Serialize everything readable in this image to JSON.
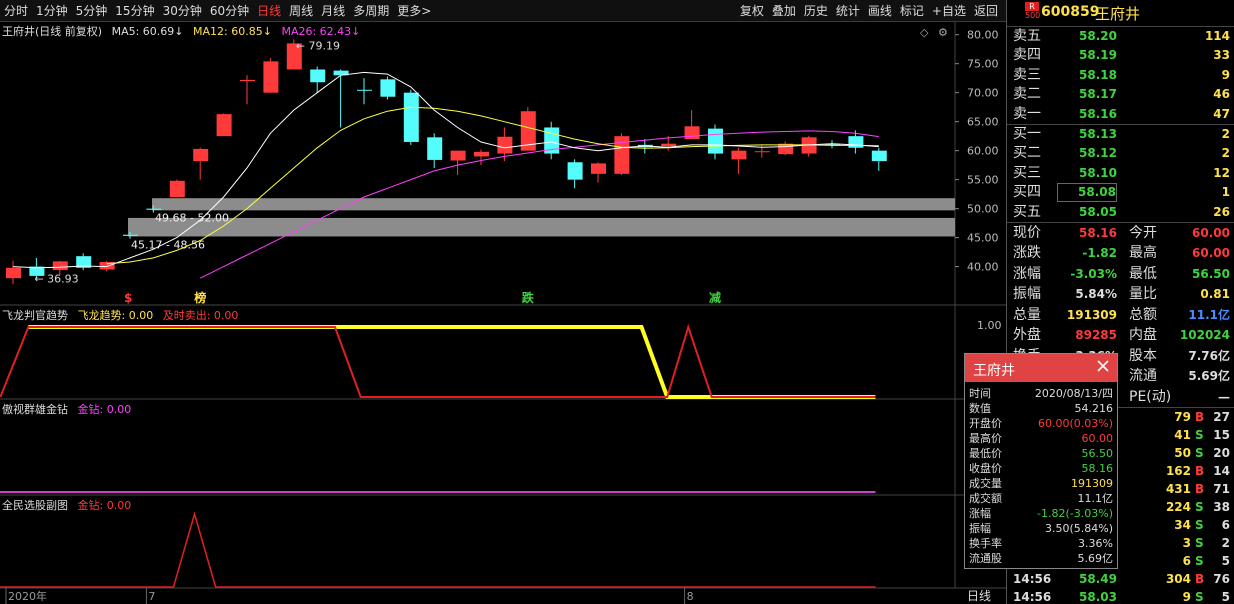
{
  "toolbar": {
    "periods": [
      "分时",
      "1分钟",
      "5分钟",
      "15分钟",
      "30分钟",
      "60分钟",
      "日线",
      "周线",
      "月线",
      "多周期",
      "更多>"
    ],
    "active_period": "日线",
    "tools": [
      "复权",
      "叠加",
      "历史",
      "统计",
      "画线",
      "标记",
      "+自选",
      "返回"
    ]
  },
  "main_chart": {
    "title": "王府井(日线 前复权)",
    "ma5_label": "MA5: 60.69↓",
    "ma12_label": "MA12: 60.85↓",
    "ma26_label": "MA26: 62.43↓",
    "price_axis": [
      "80.00",
      "75.00",
      "70.00",
      "65.00",
      "60.00",
      "55.00",
      "50.00",
      "45.00",
      "40.00"
    ],
    "y_range": [
      37,
      81.5
    ],
    "high_note": "79.19",
    "low_note": "36.93",
    "zone1_text": "49.68 - 52.00",
    "zone2_text": "45.17 - 48.56",
    "signals": [
      {
        "index": 5,
        "text": "$",
        "color": "#ff3a3a"
      },
      {
        "index": 8,
        "text": "榜",
        "color": "#ffe14d"
      },
      {
        "index": 22,
        "text": "跌",
        "color": "#3fd43f"
      },
      {
        "index": 30,
        "text": "减",
        "color": "#3fd43f"
      }
    ],
    "candles": [
      {
        "o": 38.0,
        "h": 41.0,
        "l": 37.0,
        "c": 39.8
      },
      {
        "o": 40.0,
        "h": 41.5,
        "l": 38.0,
        "c": 38.4
      },
      {
        "o": 39.4,
        "h": 41.0,
        "l": 38.5,
        "c": 40.9
      },
      {
        "o": 41.8,
        "h": 42.3,
        "l": 39.4,
        "c": 39.8
      },
      {
        "o": 39.5,
        "h": 41.0,
        "l": 39.2,
        "c": 40.8
      },
      {
        "o": 45.5,
        "h": 46.0,
        "l": 44.8,
        "c": 45.3
      },
      {
        "o": 50.0,
        "h": 50.6,
        "l": 49.3,
        "c": 49.8
      },
      {
        "o": 52.0,
        "h": 55.0,
        "l": 52.0,
        "c": 54.8
      },
      {
        "o": 58.2,
        "h": 60.5,
        "l": 55.0,
        "c": 60.3
      },
      {
        "o": 62.5,
        "h": 66.4,
        "l": 62.5,
        "c": 66.3
      },
      {
        "o": 72.0,
        "h": 73.0,
        "l": 68.0,
        "c": 72.2
      },
      {
        "o": 70.0,
        "h": 76.0,
        "l": 70.0,
        "c": 75.4
      },
      {
        "o": 74.0,
        "h": 79.19,
        "l": 74.0,
        "c": 78.5
      },
      {
        "o": 74.0,
        "h": 74.5,
        "l": 70.0,
        "c": 71.8
      },
      {
        "o": 73.8,
        "h": 74.0,
        "l": 64.0,
        "c": 73.0
      },
      {
        "o": 70.5,
        "h": 72.5,
        "l": 68.0,
        "c": 70.4
      },
      {
        "o": 72.3,
        "h": 72.8,
        "l": 68.8,
        "c": 69.3
      },
      {
        "o": 70.0,
        "h": 70.5,
        "l": 61.0,
        "c": 61.5
      },
      {
        "o": 62.3,
        "h": 63.0,
        "l": 57.0,
        "c": 58.4
      },
      {
        "o": 58.3,
        "h": 60.0,
        "l": 55.8,
        "c": 60.0
      },
      {
        "o": 59.0,
        "h": 60.2,
        "l": 57.5,
        "c": 59.8
      },
      {
        "o": 59.5,
        "h": 64.0,
        "l": 58.2,
        "c": 62.4
      },
      {
        "o": 60.0,
        "h": 67.5,
        "l": 60.0,
        "c": 66.8
      },
      {
        "o": 64.0,
        "h": 65.0,
        "l": 58.5,
        "c": 59.5
      },
      {
        "o": 58.0,
        "h": 58.5,
        "l": 53.5,
        "c": 55.0
      },
      {
        "o": 56.0,
        "h": 58.0,
        "l": 54.5,
        "c": 57.8
      },
      {
        "o": 56.0,
        "h": 63.0,
        "l": 55.8,
        "c": 62.5
      },
      {
        "o": 61.0,
        "h": 62.0,
        "l": 59.5,
        "c": 60.6
      },
      {
        "o": 60.8,
        "h": 62.5,
        "l": 60.0,
        "c": 61.2
      },
      {
        "o": 62.0,
        "h": 67.0,
        "l": 62.0,
        "c": 64.2
      },
      {
        "o": 63.8,
        "h": 64.5,
        "l": 58.5,
        "c": 59.5
      },
      {
        "o": 58.5,
        "h": 60.5,
        "l": 56.0,
        "c": 60.0
      },
      {
        "o": 59.8,
        "h": 61.0,
        "l": 58.8,
        "c": 59.9
      },
      {
        "o": 59.4,
        "h": 61.6,
        "l": 59.2,
        "c": 61.2
      },
      {
        "o": 59.5,
        "h": 62.5,
        "l": 59.0,
        "c": 62.3
      },
      {
        "o": 61.2,
        "h": 61.8,
        "l": 60.4,
        "c": 61.0
      },
      {
        "o": 62.5,
        "h": 63.5,
        "l": 59.5,
        "c": 60.5
      },
      {
        "o": 60.0,
        "h": 60.5,
        "l": 56.5,
        "c": 58.2
      }
    ],
    "ma5": [
      40.0,
      39.8,
      39.9,
      40.1,
      40.0,
      41.5,
      43.0,
      45.0,
      48.0,
      52.0,
      57.0,
      63.0,
      67.0,
      70.0,
      73.0,
      73.5,
      73.2,
      71.0,
      67.0,
      64.0,
      61.5,
      60.5,
      61.0,
      61.5,
      60.5,
      60.0,
      60.5,
      60.8,
      60.6,
      61.0,
      61.0,
      60.8,
      60.6,
      60.7,
      61.0,
      61.2,
      61.0,
      60.7
    ],
    "ma12": [
      null,
      null,
      null,
      null,
      40.5,
      40.8,
      41.5,
      42.8,
      44.5,
      47.0,
      50.0,
      53.5,
      57.0,
      60.5,
      63.5,
      65.5,
      66.8,
      67.5,
      67.3,
      66.8,
      66.0,
      65.0,
      64.0,
      63.0,
      62.0,
      61.2,
      60.6,
      60.4,
      60.5,
      60.7,
      60.8,
      60.9,
      61.0,
      61.0,
      61.0,
      60.9,
      60.9,
      60.85
    ],
    "ma26": [
      null,
      null,
      null,
      null,
      null,
      null,
      null,
      null,
      38.0,
      40.0,
      42.0,
      44.0,
      46.0,
      48.0,
      50.0,
      52.0,
      53.5,
      55.0,
      56.5,
      57.5,
      58.3,
      59.0,
      59.6,
      60.2,
      60.6,
      61.0,
      61.4,
      61.8,
      62.2,
      62.5,
      62.8,
      63.0,
      63.2,
      63.3,
      63.4,
      63.3,
      63.0,
      62.43
    ],
    "x_labels": [
      {
        "index": 0,
        "text": "2020年"
      },
      {
        "index": 6,
        "text": "7"
      },
      {
        "index": 29,
        "text": "8"
      }
    ]
  },
  "pane1": {
    "name": "飞龙判官趋势",
    "label_a": "飞龙趋势: 0.00",
    "label_b": "及时卖出: 0.00",
    "axis_value": "1.00"
  },
  "pane2": {
    "name": "傲视群雄金钻",
    "label_a": "金钻: 0.00"
  },
  "pane3": {
    "name": "全民选股副图",
    "label_a": "金钻: 0.00"
  },
  "bottom_axis_label": "日线",
  "quote": {
    "badge_top": "R",
    "badge_bottom": "500",
    "code": "600859",
    "name": "王府井",
    "asks": [
      {
        "label": "卖五",
        "price": "58.20",
        "vol": "114"
      },
      {
        "label": "卖四",
        "price": "58.19",
        "vol": "33"
      },
      {
        "label": "卖三",
        "price": "58.18",
        "vol": "9"
      },
      {
        "label": "卖二",
        "price": "58.17",
        "vol": "46"
      },
      {
        "label": "卖一",
        "price": "58.16",
        "vol": "47"
      }
    ],
    "bids": [
      {
        "label": "买一",
        "price": "58.13",
        "vol": "2"
      },
      {
        "label": "买二",
        "price": "58.12",
        "vol": "2"
      },
      {
        "label": "买三",
        "price": "58.10",
        "vol": "12"
      },
      {
        "label": "买四",
        "price": "58.08",
        "vol": "1"
      },
      {
        "label": "买五",
        "price": "58.05",
        "vol": "26"
      }
    ],
    "stats": [
      {
        "l1": "现价",
        "v1": "58.16",
        "c1": "red",
        "l2": "今开",
        "v2": "60.00",
        "c2": "red"
      },
      {
        "l1": "涨跌",
        "v1": "-1.82",
        "c1": "green",
        "l2": "最高",
        "v2": "60.00",
        "c2": "red"
      },
      {
        "l1": "涨幅",
        "v1": "-3.03%",
        "c1": "green",
        "l2": "最低",
        "v2": "56.50",
        "c2": "green"
      },
      {
        "l1": "振幅",
        "v1": "5.84%",
        "c1": "white",
        "l2": "量比",
        "v2": "0.81",
        "c2": "yellow"
      },
      {
        "l1": "总量",
        "v1": "191309",
        "c1": "yellow",
        "l2": "总额",
        "v2": "11.1亿",
        "c2": "blue"
      },
      {
        "l1": "外盘",
        "v1": "89285",
        "c1": "red",
        "l2": "内盘",
        "v2": "102024",
        "c2": "green"
      },
      {
        "l1": "换手",
        "v1": "3.36%",
        "c1": "white",
        "l2": "股本",
        "v2": "7.76亿",
        "c2": "white"
      },
      {
        "l1": "",
        "v1": "",
        "c1": "white",
        "l2": "流通",
        "v2": "5.69亿",
        "c2": "white"
      },
      {
        "l1": "",
        "v1": "",
        "c1": "white",
        "l2": "PE(动)",
        "v2": "—",
        "c2": "white"
      }
    ],
    "ticks": [
      {
        "t": "",
        "p": "",
        "pc": "red",
        "v": "79",
        "bs": "B",
        "n": "27"
      },
      {
        "t": "",
        "p": "",
        "pc": "red",
        "v": "41",
        "bs": "S",
        "n": "15"
      },
      {
        "t": "",
        "p": "",
        "pc": "red",
        "v": "50",
        "bs": "S",
        "n": "20"
      },
      {
        "t": "",
        "p": "",
        "pc": "red",
        "v": "162",
        "bs": "B",
        "n": "14"
      },
      {
        "t": "",
        "p": "",
        "pc": "red",
        "v": "431",
        "bs": "B",
        "n": "71"
      },
      {
        "t": "",
        "p": "",
        "pc": "red",
        "v": "224",
        "bs": "S",
        "n": "38"
      },
      {
        "t": "",
        "p": "",
        "pc": "red",
        "v": "34",
        "bs": "S",
        "n": "6"
      },
      {
        "t": "",
        "p": "",
        "pc": "red",
        "v": "3",
        "bs": "S",
        "n": "2"
      },
      {
        "t": "",
        "p": "",
        "pc": "red",
        "v": "6",
        "bs": "S",
        "n": "5"
      },
      {
        "t": "14:56",
        "p": "58.49",
        "pc": "green",
        "v": "304",
        "bs": "B",
        "n": "76"
      },
      {
        "t": "14:56",
        "p": "58.03",
        "pc": "green",
        "v": "9",
        "bs": "S",
        "n": "5"
      }
    ]
  },
  "popup": {
    "title": "王府井",
    "rows": [
      {
        "k": "时间",
        "v": "2020/08/13/四",
        "c": "white"
      },
      {
        "k": "数值",
        "v": "54.216",
        "c": "white"
      },
      {
        "k": "开盘价",
        "v": "60.00(0.03%)",
        "c": "red"
      },
      {
        "k": "最高价",
        "v": "60.00",
        "c": "red"
      },
      {
        "k": "最低价",
        "v": "56.50",
        "c": "green"
      },
      {
        "k": "收盘价",
        "v": "58.16",
        "c": "green"
      },
      {
        "k": "成交量",
        "v": "191309",
        "c": "yellow"
      },
      {
        "k": "成交额",
        "v": "11.1亿",
        "c": "white"
      },
      {
        "k": "涨幅",
        "v": "-1.82(-3.03%)",
        "c": "green"
      },
      {
        "k": "振幅",
        "v": "3.50(5.84%)",
        "c": "white"
      },
      {
        "k": "换手率",
        "v": "3.36%",
        "c": "white"
      },
      {
        "k": "流通股",
        "v": "5.69亿",
        "c": "white"
      }
    ]
  },
  "colors": {
    "up": "#ff3a3a",
    "down": "#54fcfc",
    "ma5": "#ffffff",
    "ma12": "#ffff40",
    "ma26": "#ff40ff",
    "blue": "#4d8cff"
  }
}
